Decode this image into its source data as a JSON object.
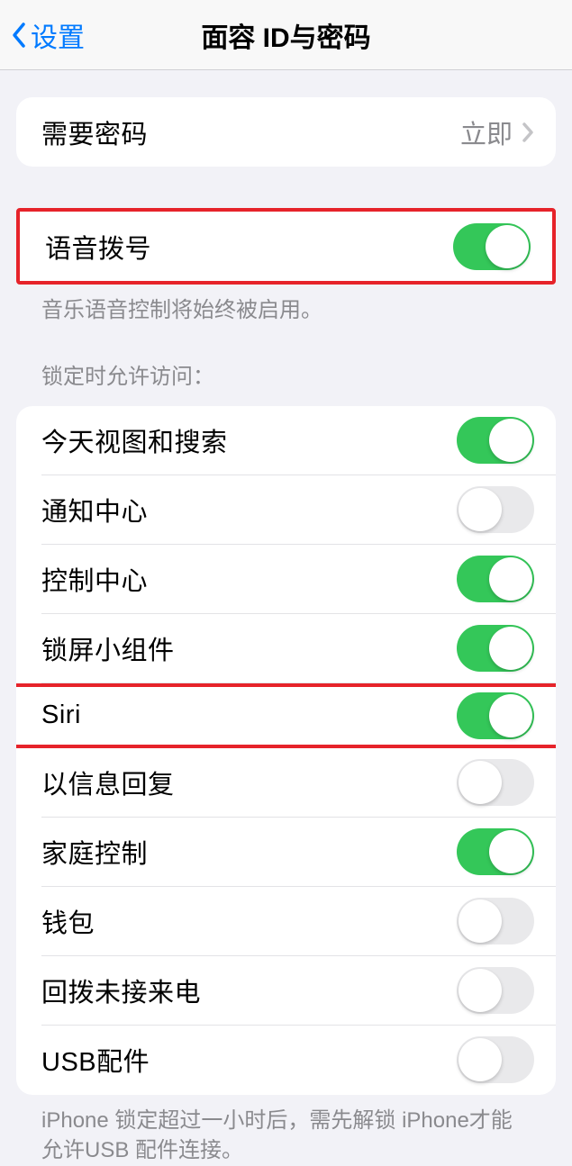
{
  "nav": {
    "back_label": "设置",
    "title": "面容 ID与密码"
  },
  "require_passcode": {
    "label": "需要密码",
    "value": "立即"
  },
  "voice_dial": {
    "label": "语音拨号",
    "enabled": true,
    "footer": "音乐语音控制将始终被启用。"
  },
  "lock_access": {
    "header": "锁定时允许访问：",
    "items": [
      {
        "label": "今天视图和搜索",
        "enabled": true
      },
      {
        "label": "通知中心",
        "enabled": false
      },
      {
        "label": "控制中心",
        "enabled": true
      },
      {
        "label": "锁屏小组件",
        "enabled": true
      },
      {
        "label": "Siri",
        "enabled": true
      },
      {
        "label": "以信息回复",
        "enabled": false
      },
      {
        "label": "家庭控制",
        "enabled": true
      },
      {
        "label": "钱包",
        "enabled": false
      },
      {
        "label": "回拨未接来电",
        "enabled": false
      },
      {
        "label": "USB配件",
        "enabled": false
      }
    ],
    "footer": "iPhone 锁定超过一小时后，需先解锁 iPhone才能允许USB 配件连接。"
  }
}
